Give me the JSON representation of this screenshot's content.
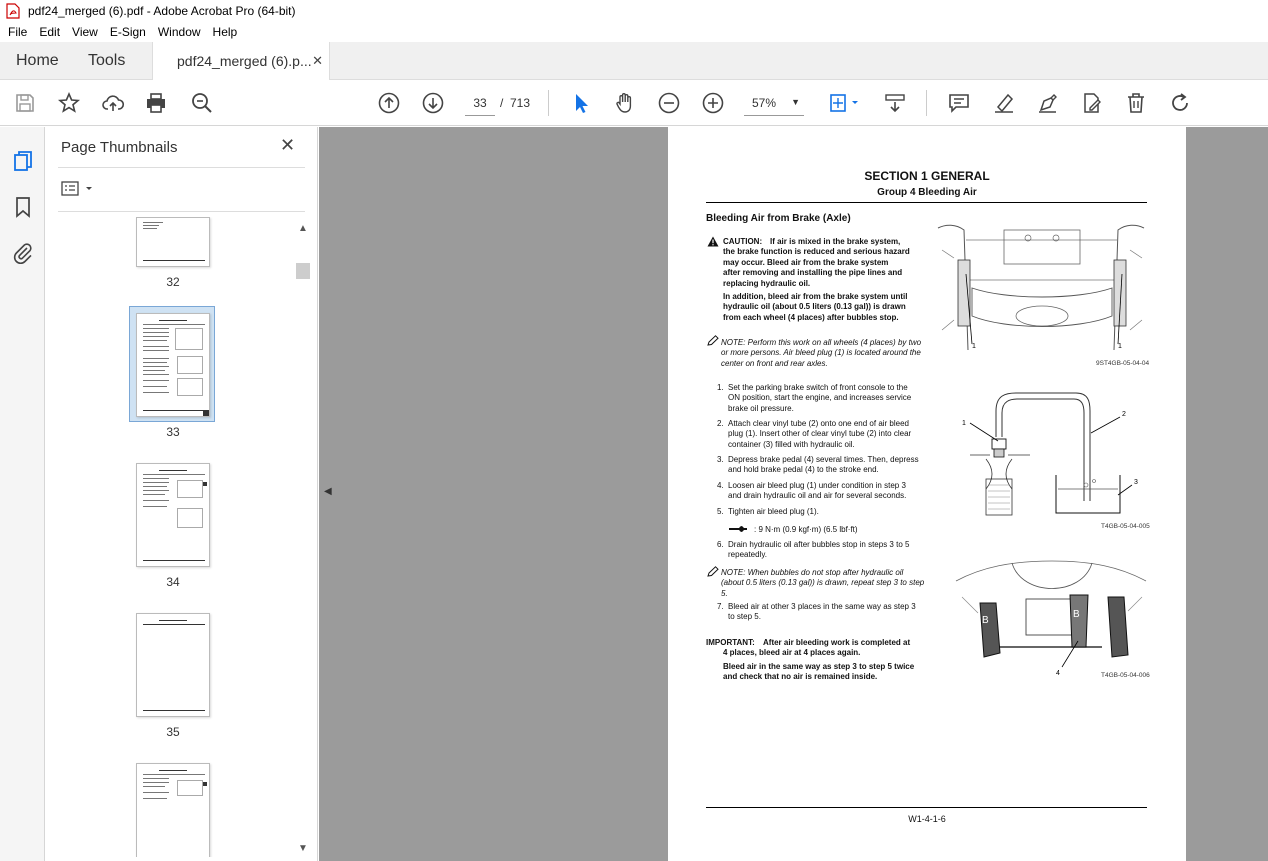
{
  "window": {
    "title": "pdf24_merged (6).pdf - Adobe Acrobat Pro (64-bit)"
  },
  "menu": [
    "File",
    "Edit",
    "View",
    "E-Sign",
    "Window",
    "Help"
  ],
  "tabs": {
    "home": "Home",
    "tools": "Tools",
    "document": "pdf24_merged (6).p...",
    "close_glyph": "✕"
  },
  "toolbar": {
    "current_page": "33",
    "page_separator": "/",
    "total_pages": "713",
    "zoom": "57%"
  },
  "thumbnails_panel": {
    "title": "Page Thumbnails",
    "close_glyph": "✕",
    "pages": [
      {
        "label": "32"
      },
      {
        "label": "33",
        "selected": true
      },
      {
        "label": "34"
      },
      {
        "label": "35"
      }
    ]
  },
  "document": {
    "section": "SECTION 1 GENERAL",
    "group": "Group 4 Bleeding Air",
    "heading": "Bleeding Air from Brake (Axle)",
    "caution": {
      "label": "CAUTION:",
      "lines": [
        "If air is mixed in the brake system,",
        "the brake function is reduced and serious hazard",
        "may occur. Bleed air from the brake system",
        "after removing and installing the pipe lines and",
        "replacing hydraulic oil."
      ],
      "lines2": [
        "In addition, bleed air from the brake system until",
        "hydraulic oil (about 0.5 liters (0.13 gal)) is drawn",
        "from each wheel (4 places) after bubbles stop."
      ]
    },
    "note1": [
      "NOTE:   Perform this work on all wheels (4 places) by two",
      "or more persons. Air bleed plug (1) is located around the",
      "center on front and rear axles."
    ],
    "steps": [
      [
        "1.",
        "Set the parking brake switch of front console to the",
        "ON position, start the engine, and increases service",
        "brake oil pressure."
      ],
      [
        "2.",
        "Attach clear vinyl tube (2) onto one end of air bleed",
        "plug (1). Insert other of clear vinyl tube (2) into clear",
        "container (3) filled with hydraulic oil."
      ],
      [
        "3.",
        "Depress brake pedal (4) several times. Then, depress",
        "and hold brake pedal (4) to the stroke end."
      ],
      [
        "4.",
        "Loosen air bleed plug (1) under condition in step 3",
        "and drain hydraulic oil and air for several seconds."
      ],
      [
        "5.",
        "Tighten air bleed plug (1)."
      ]
    ],
    "torque": ": 9 N·m (0.9 kgf·m) (6.5 lbf·ft)",
    "step6": [
      "6.",
      "Drain hydraulic oil after bubbles stop in steps 3 to 5",
      "repeatedly."
    ],
    "note2": [
      "NOTE:   When bubbles do not stop after hydraulic oil",
      "(about 0.5 liters (0.13 gal)) is drawn, repeat step 3 to step",
      "5."
    ],
    "step7": [
      "7.",
      "Bleed air at other 3 places in the same way as step 3",
      "to step 5."
    ],
    "important": {
      "label": "IMPORTANT:",
      "lines": [
        "After air bleeding work is completed at",
        "4 places, bleed air at 4 places again.",
        "Bleed air in the same way as step 3 to step 5 twice",
        "and check that no air is remained inside."
      ]
    },
    "figures": {
      "fig1_caption": "9ST4GB-05-04-04",
      "fig1_callouts": [
        "1",
        "1"
      ],
      "fig2_caption": "T4GB-05-04-005",
      "fig2_callouts": [
        "1",
        "2",
        "3"
      ],
      "fig3_caption": "T4GB-05-04-006",
      "fig3_callouts": [
        "B",
        "B",
        "4"
      ]
    },
    "footer": "W1-4-1-6"
  }
}
